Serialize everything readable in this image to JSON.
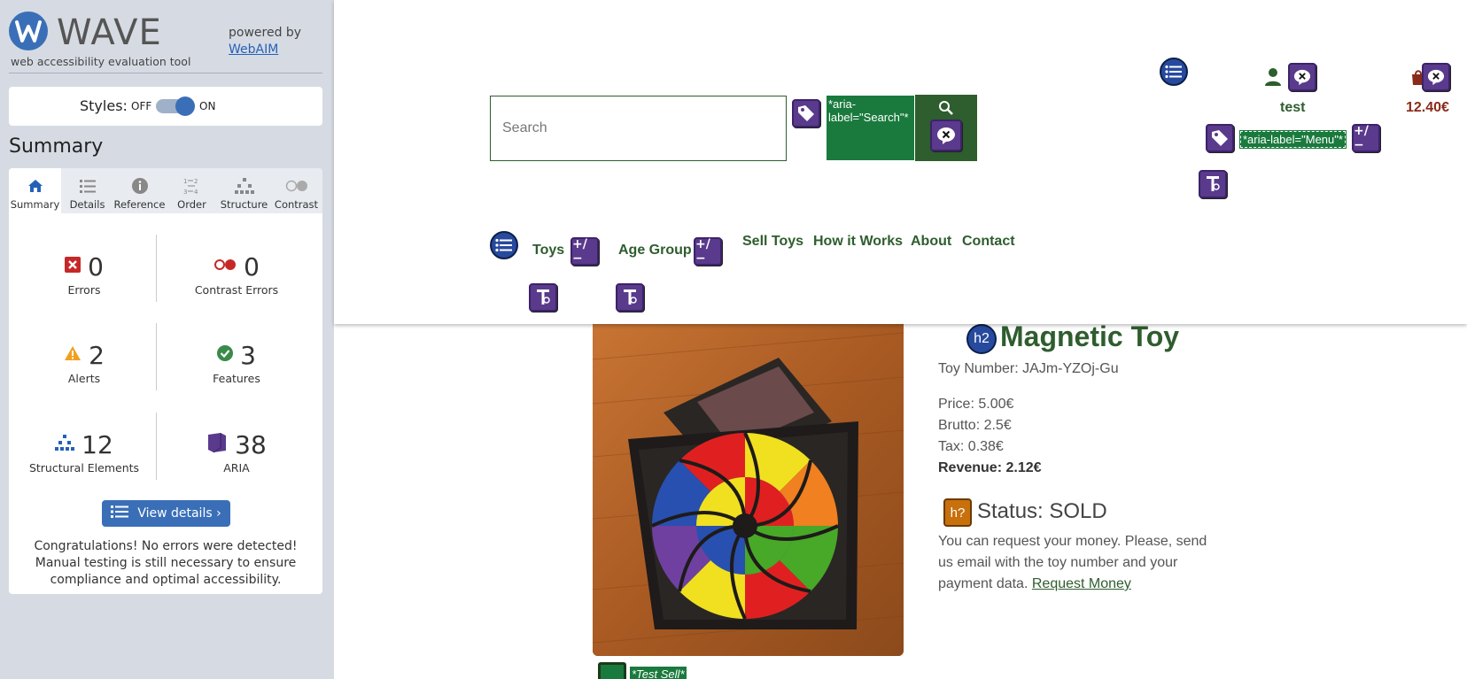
{
  "wave": {
    "brand": "WAVE",
    "tagline": "web accessibility evaluation tool",
    "powered_by": "powered by",
    "webaim_link": "WebAIM",
    "styles_label": "Styles:",
    "styles_off": "OFF",
    "styles_on": "ON",
    "styles_enabled": true,
    "summary_heading": "Summary",
    "tabs": [
      {
        "label": "Summary",
        "icon": "home-icon",
        "active": true
      },
      {
        "label": "Details",
        "icon": "list-icon",
        "active": false
      },
      {
        "label": "Reference",
        "icon": "info-icon",
        "active": false
      },
      {
        "label": "Order",
        "icon": "order-icon",
        "active": false
      },
      {
        "label": "Structure",
        "icon": "structure-icon",
        "active": false
      },
      {
        "label": "Contrast",
        "icon": "contrast-icon",
        "active": false
      }
    ],
    "stats": {
      "errors": {
        "count": "0",
        "label": "Errors",
        "color": "#c62828"
      },
      "contrast_errors": {
        "count": "0",
        "label": "Contrast Errors",
        "color": "#c62828"
      },
      "alerts": {
        "count": "2",
        "label": "Alerts",
        "color": "#f0a020"
      },
      "features": {
        "count": "3",
        "label": "Features",
        "color": "#3a8a4a"
      },
      "structural": {
        "count": "12",
        "label": "Structural Elements",
        "color": "#2561b8"
      },
      "aria": {
        "count": "38",
        "label": "ARIA",
        "color": "#5a3a8c"
      }
    },
    "view_details": "View details ›",
    "congrats": "Congratulations! No errors were detected! Manual testing is still necessary to ensure compliance and optimal accessibility."
  },
  "site": {
    "search_placeholder": "Search",
    "search_aria": "*aria-label=\"Search\"*",
    "menu_aria": "*aria-label=\"Menu\"*",
    "user_name": "test",
    "cart_total": "12.40€",
    "nav": [
      "Toys",
      "Age Group",
      "Sell Toys",
      "How it Works",
      "About",
      "Contact"
    ],
    "wave_plus_minus": "+/−",
    "product": {
      "title": "Magnetic Toy",
      "heading_badge": "h2",
      "toy_number": "Toy Number: JAJm-YZOj-Gu",
      "price": "Price: 5.00€",
      "brutto": "Brutto: 2.5€",
      "tax": "Tax: 0.38€",
      "revenue": "Revenue: 2.12€",
      "status_badge": "h?",
      "status": "Status: SOLD",
      "desc": "You can request your money. Please, send us email with the toy number and your payment data.",
      "request_link": "Request Money",
      "image_alt_label": "*Test Sell*"
    },
    "colors": {
      "accent_green": "#2e5d2e",
      "aria_green": "#1a7a3d",
      "wave_purple": "#5a3a8c",
      "cart_red": "#8a2a1a"
    }
  }
}
